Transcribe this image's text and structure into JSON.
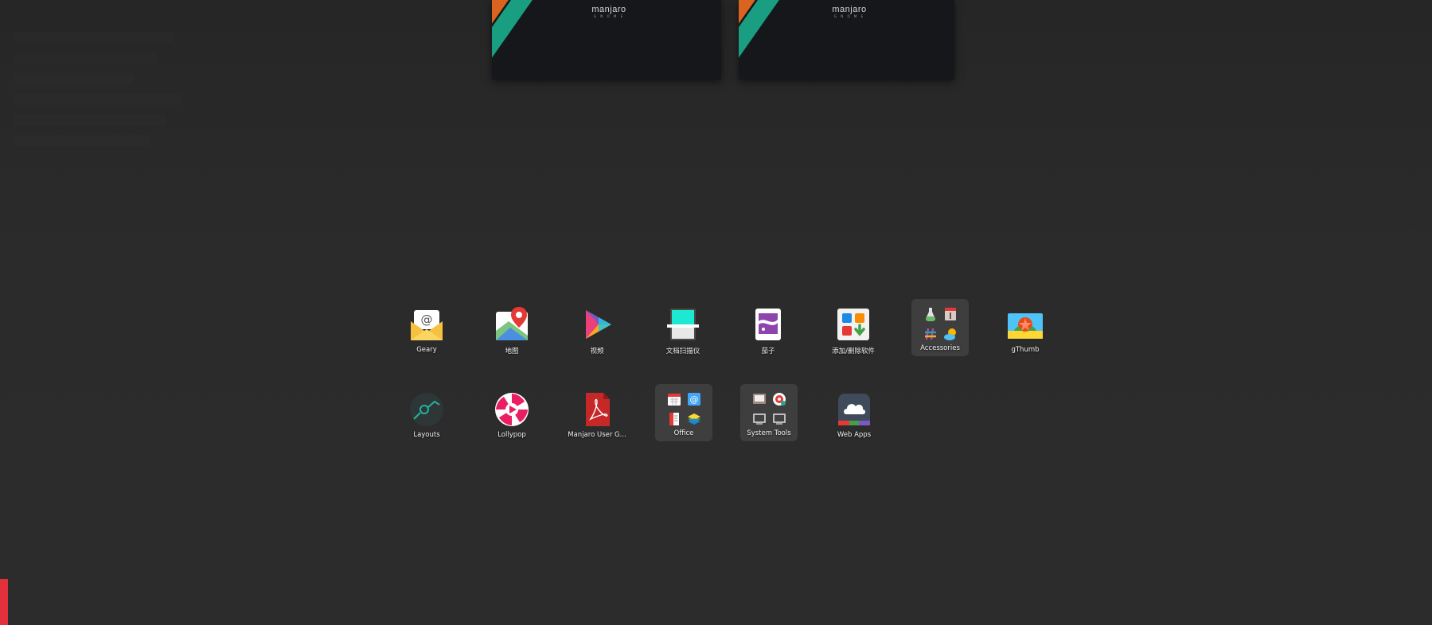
{
  "workspaces": [
    {
      "logo_text": "manjaro",
      "logo_sub": "G N O M E"
    },
    {
      "logo_text": "manjaro",
      "logo_sub": "G N O M E"
    }
  ],
  "apps": {
    "row1": [
      {
        "label": "Geary",
        "icon": "mail-envelope-icon"
      },
      {
        "label": "地图",
        "icon": "maps-pin-icon"
      },
      {
        "label": "视频",
        "icon": "video-play-icon"
      },
      {
        "label": "文档扫描仪",
        "icon": "document-scanner-icon"
      },
      {
        "label": "茄子",
        "icon": "cheese-camera-icon"
      },
      {
        "label": "添加/删除软件",
        "icon": "software-manager-icon"
      },
      {
        "label": "Accessories",
        "icon": "folder-icon"
      },
      {
        "label": "gThumb",
        "icon": "gthumb-image-icon"
      }
    ],
    "row2": [
      {
        "label": "Layouts",
        "icon": "layouts-icon"
      },
      {
        "label": "Lollypop",
        "icon": "lollypop-icon"
      },
      {
        "label": "Manjaro User G...",
        "icon": "pdf-document-icon"
      },
      {
        "label": "Office",
        "icon": "folder-icon"
      },
      {
        "label": "System Tools",
        "icon": "folder-icon"
      },
      {
        "label": "Web Apps",
        "icon": "cloud-web-icon"
      }
    ]
  },
  "colors": {
    "background": "#2b2b2b",
    "folder_tile": "#3b3b3b",
    "manjaro_orange": "#d9641f",
    "manjaro_green": "#199e82",
    "hint_red": "#e2313a"
  }
}
